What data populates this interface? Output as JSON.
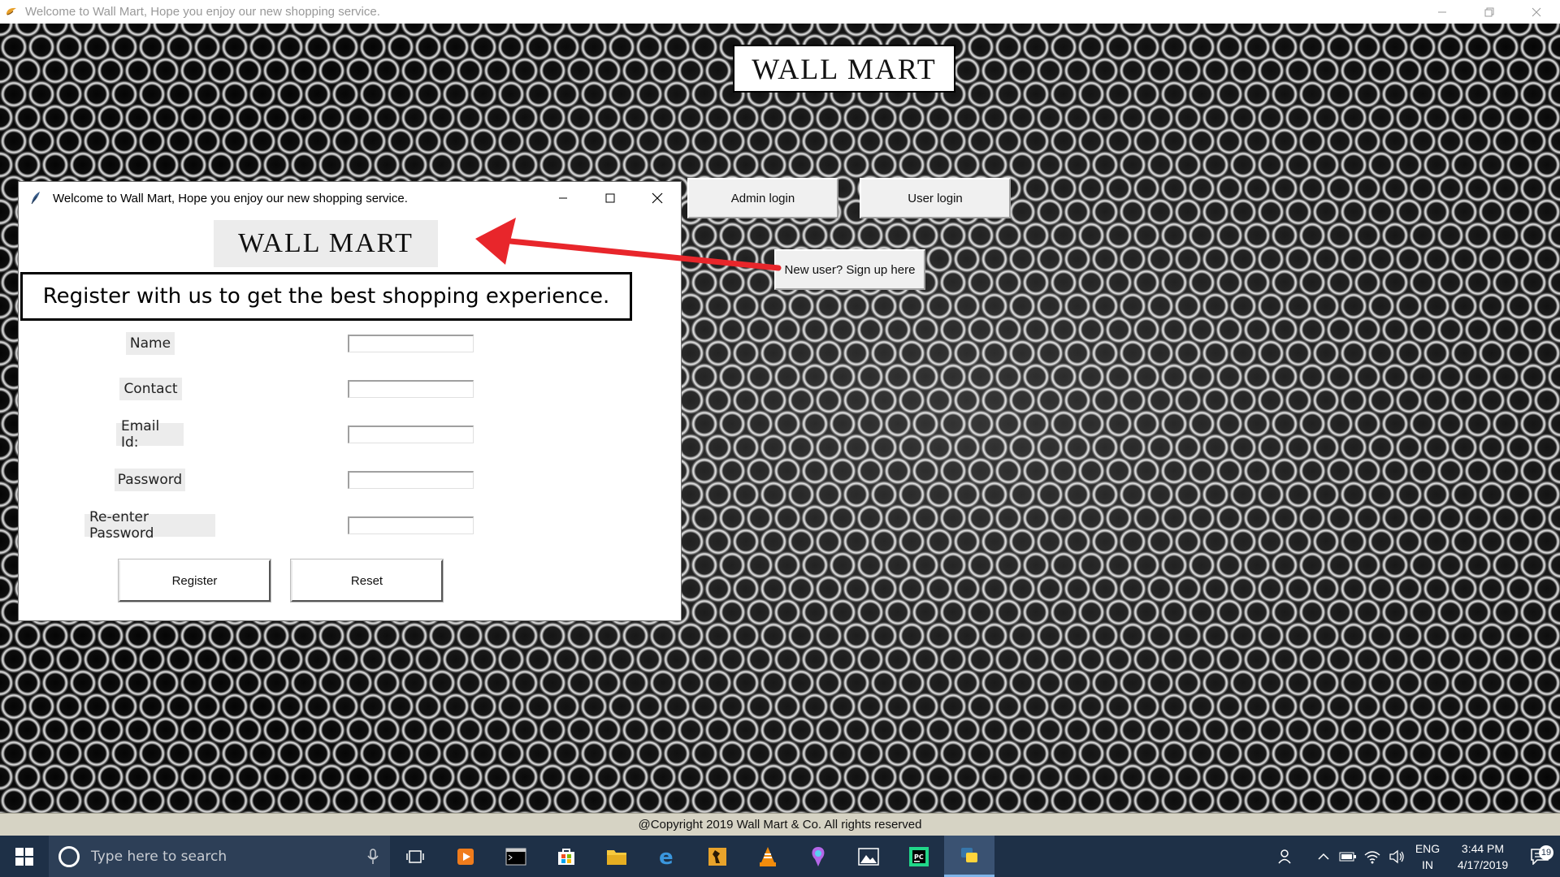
{
  "main_window": {
    "title": "Welcome to Wall Mart, Hope you enjoy our new shopping service.",
    "logo": "WALL MART",
    "buttons": {
      "admin_login": "Admin login",
      "user_login": "User login",
      "signup": "New user? Sign up here"
    },
    "footer": "@Copyright 2019 Wall Mart & Co. All rights reserved"
  },
  "register_window": {
    "title": "Welcome to Wall Mart, Hope you enjoy our new shopping service.",
    "logo": "WALL MART",
    "heading": "Register with us to get the best shopping experience.",
    "fields": [
      {
        "label": "Name",
        "value": ""
      },
      {
        "label": "Contact",
        "value": ""
      },
      {
        "label": "Email Id:",
        "value": ""
      },
      {
        "label": "Password",
        "value": ""
      },
      {
        "label": "Re-enter Password",
        "value": ""
      }
    ],
    "register_button": "Register",
    "reset_button": "Reset"
  },
  "taskbar": {
    "search_placeholder": "Type here to search",
    "apps": [
      "task-view-icon",
      "media-player-icon",
      "terminal-icon",
      "store-icon",
      "file-explorer-icon",
      "edge-icon",
      "counter-strike-icon",
      "vlc-icon",
      "paint3d-icon",
      "photos-icon",
      "pycharm-icon",
      "python-icon"
    ],
    "language_line1": "ENG",
    "language_line2": "IN",
    "time": "3:44 PM",
    "date": "4/17/2019",
    "notification_count": "19"
  },
  "colors": {
    "taskbar": "#1e3047",
    "footer": "#d6d3c4",
    "arrow": "#e8262b"
  }
}
